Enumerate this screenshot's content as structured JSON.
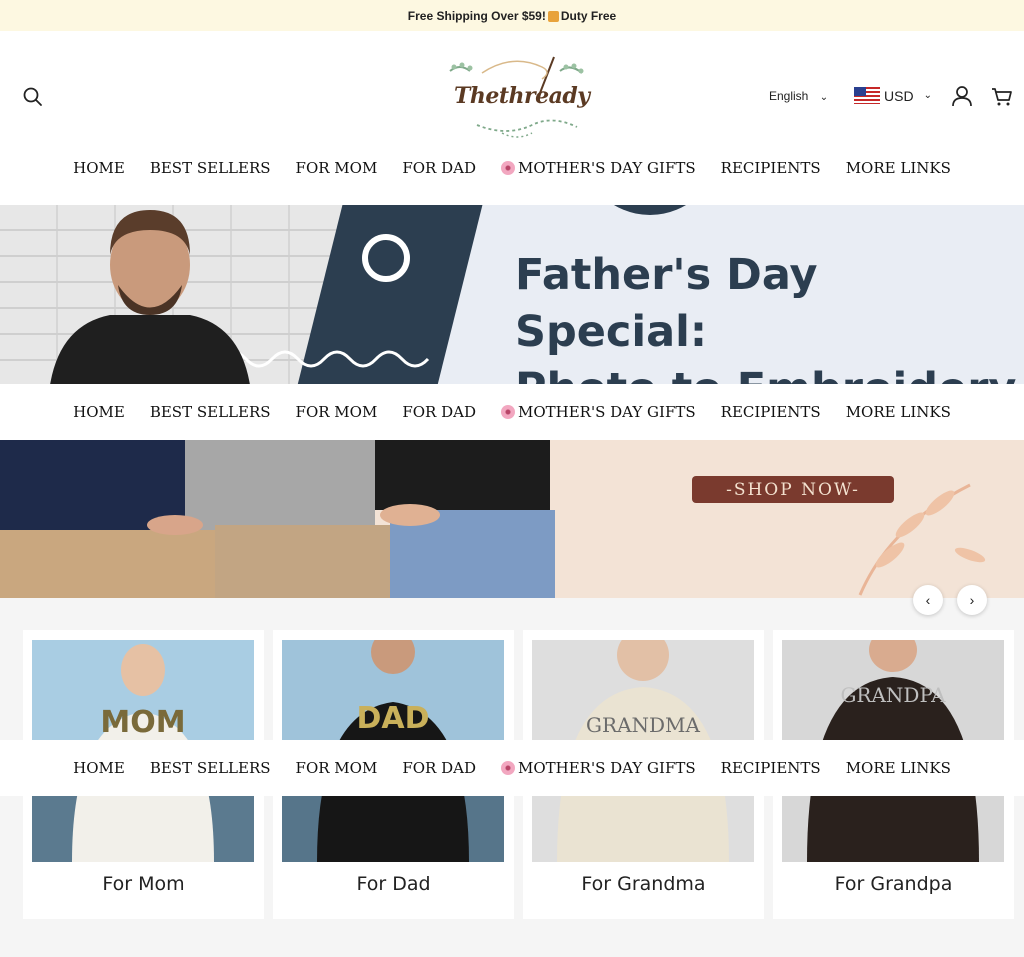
{
  "announcement": {
    "text_before": "Free Shipping Over $59! ",
    "text_after": "Duty Free"
  },
  "header": {
    "logo_text": "Thethready",
    "language": "English",
    "currency": "USD"
  },
  "nav": {
    "items": [
      "HOME",
      "BEST SELLERS",
      "FOR MOM",
      "FOR DAD",
      "MOTHER'S DAY GIFTS",
      "RECIPIENTS",
      "MORE LINKS"
    ]
  },
  "hero": {
    "headline_line1": "Father's Day Special:",
    "headline_line2": "Photo to Embroidery",
    "cta": "-SHOP NOW-"
  },
  "collections": [
    {
      "label": "For Mom",
      "print": "MOM"
    },
    {
      "label": "For Dad",
      "print": "DAD"
    },
    {
      "label": "For Grandma",
      "print": "GRANDMA"
    },
    {
      "label": "For Grandpa",
      "print": "GRANDPA"
    }
  ],
  "colors": {
    "announce_bg": "#fdf8e1",
    "navy": "#2c3e50",
    "shop_button": "#7a3a2e",
    "section_bg": "#f5f5f5"
  }
}
